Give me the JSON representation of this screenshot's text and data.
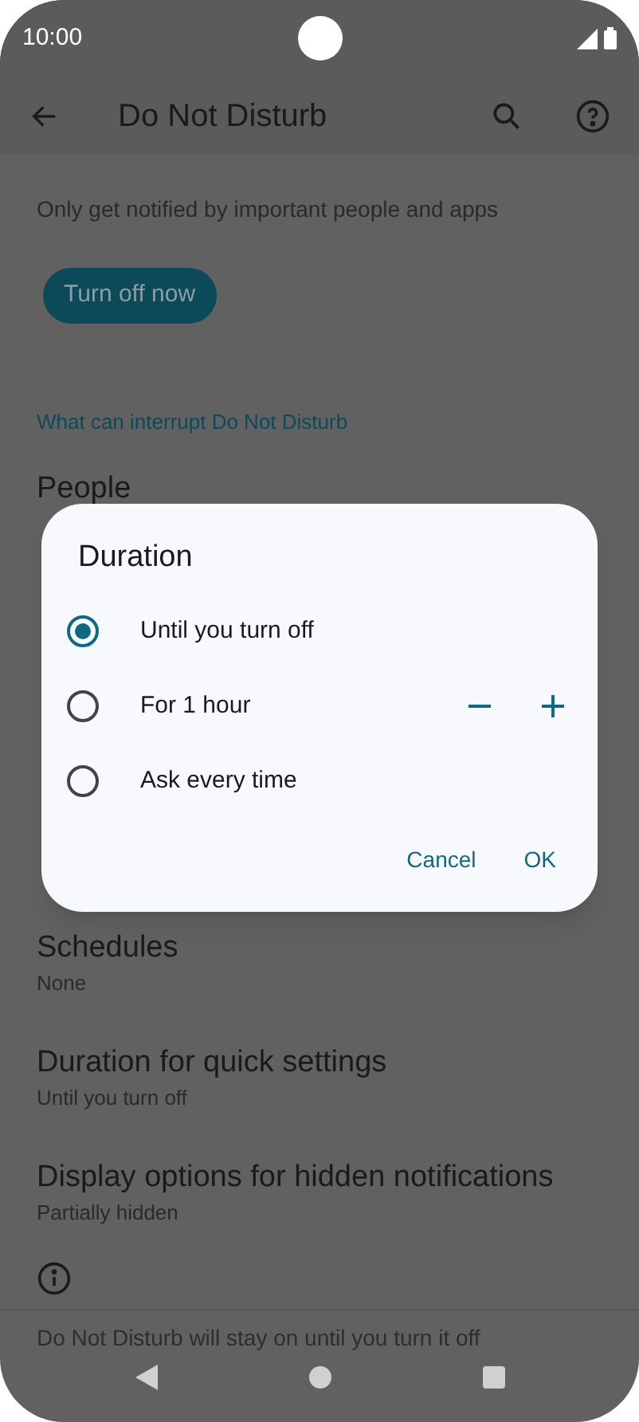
{
  "status_bar": {
    "time": "10:00"
  },
  "app_bar": {
    "title": "Do Not Disturb"
  },
  "description": "Only get notified by important people and apps",
  "turn_off_button": "Turn off now",
  "section_header": "What can interrupt Do Not Disturb",
  "partial_item": "People",
  "settings": [
    {
      "title": "Schedules",
      "subtitle": "None"
    },
    {
      "title": "Duration for quick settings",
      "subtitle": "Until you turn off"
    },
    {
      "title": "Display options for hidden notifications",
      "subtitle": "Partially hidden"
    }
  ],
  "footer": "Do Not Disturb will stay on until you turn it off",
  "dialog": {
    "title": "Duration",
    "options": [
      {
        "label": "Until you turn off",
        "selected": true,
        "kind": "plain"
      },
      {
        "label": "For 1 hour",
        "selected": false,
        "kind": "stepper"
      },
      {
        "label": "Ask every time",
        "selected": false,
        "kind": "plain"
      }
    ],
    "buttons": [
      "Cancel",
      "OK"
    ]
  }
}
